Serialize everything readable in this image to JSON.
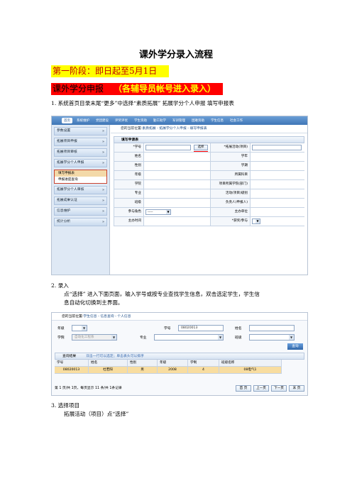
{
  "doc": {
    "title": "课外学分录入流程",
    "phase_label": "第一阶段：即日起至5月1日",
    "apply_label": "课外学分申报",
    "apply_note": "（各辅导员帐号进入录入）",
    "step1": "1.   系统首页目录末尾“更多”中选择“素质拓展”  拓展学分个人申报    填写申报表",
    "step2_head": "2.   录入",
    "step2_line1": "点“选择”  进入下面页面，输入学号或按专业查找学生信息，双击选定学生，学生信",
    "step2_line2": "息自动化切换到主界面。",
    "step3_head": "3.   选择项目",
    "step3_line1": "拓展活动（项目）点“选择”"
  },
  "shot1": {
    "nav": [
      "首页",
      "系统维护",
      "党团建设",
      "评奖评优",
      "学生资助",
      "勤工助学",
      "军训管理",
      "困难资助",
      "学生信息",
      "社会工作"
    ],
    "crumb_prefix": "您的当前位置:",
    "crumb_path": "素质拓展 - 拓展学分个人申报 - 填写申报表",
    "sidebar": [
      "参数设置",
      "拓展项目申报",
      "拓展项目审核",
      "拓展学分个人申报"
    ],
    "sidebar_sub": [
      "填写申报表",
      "申报进度查询"
    ],
    "sidebar_more": [
      "拓展学分个人审核",
      "拓展成果认证",
      "信息维护",
      "统计分析"
    ],
    "panel_title": "填写申请表",
    "select_btn": "选择",
    "field_rows": [
      [
        "*学号",
        "*拓展活动(项目)"
      ],
      [
        "姓名",
        "学年"
      ],
      [
        "性别",
        "学期"
      ],
      [
        "年级",
        "所属科目"
      ],
      [
        "学院",
        "项目所属学院(部门)"
      ],
      [
        "专业",
        "活动(项目)级别"
      ],
      [
        "班级",
        "负责人(申报人)"
      ],
      [
        "参与角色",
        "主办单位"
      ],
      [
        "主办时间",
        "*获奖/参与"
      ]
    ],
    "role_value": "-----"
  },
  "shot2": {
    "crumb_prefix": "您的当前位置:",
    "crumb_path": "学生信息 - 信息查询 - 个人信息",
    "labels": {
      "grade": "年级",
      "id": "学号",
      "name": "姓名",
      "college": "学院",
      "major": "专业",
      "class": "班级"
    },
    "id_value": "08020013",
    "college_value": "自动化工程系",
    "query_btn": "查询",
    "result_title": "查询结果",
    "result_hint": "双击一行可以选定；单击表头可以排序",
    "columns": [
      "学号",
      "姓名",
      "性别",
      "年级",
      "学制",
      "班级名称"
    ],
    "rows": [
      [
        "08020013",
        "杜若阳",
        "男",
        "2008",
        "4",
        "08电气1"
      ]
    ],
    "pager_text": "第  1  页/共 1页，每页显示  11  条/共 1条记录",
    "pager_buttons": [
      "首 页",
      "上一页",
      "下一页",
      "末 页"
    ]
  }
}
